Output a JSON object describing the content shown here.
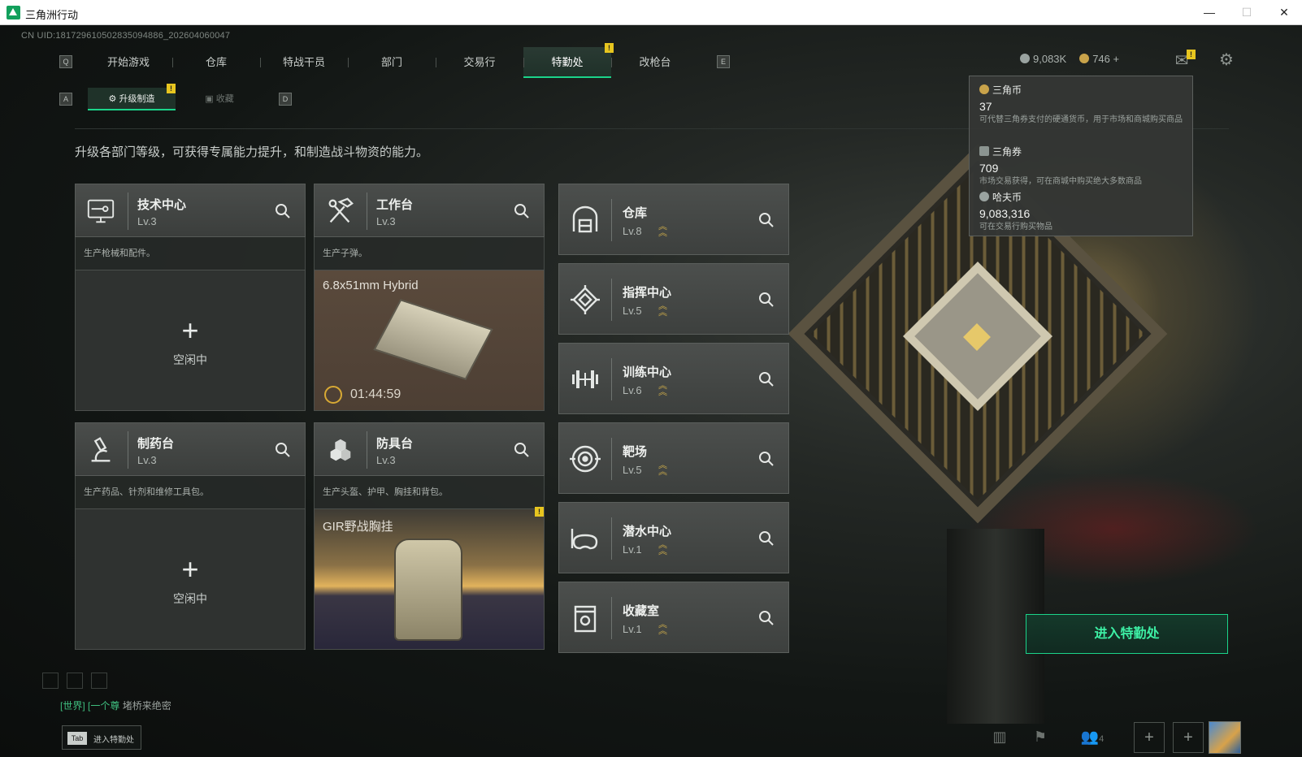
{
  "window": {
    "title": "三角洲行动",
    "minimize": "—",
    "maximize": "☐",
    "close": "✕"
  },
  "uid": "CN UID:18172961050283509488​6_202604060047",
  "nav": {
    "key_left": "Q",
    "key_right": "E",
    "tabs": [
      "开始游戏",
      "仓库",
      "特战干员",
      "部门",
      "交易行",
      "特勤处",
      "改枪台"
    ],
    "active_tab": "特勤处",
    "badge": "!"
  },
  "subnav": {
    "key_left": "A",
    "key_right": "D",
    "items": [
      "升级制造",
      "收藏"
    ],
    "active": "升级制造",
    "badge": "!"
  },
  "currency": {
    "hafcoin": "9,083K",
    "triangle": "746",
    "add": "+",
    "mail_badge": "!"
  },
  "intro": "升级各部门等级，可获得专属能力提升，和制造战斗物资的能力。",
  "workshops": [
    {
      "name": "技术中心",
      "level": "Lv.3",
      "icon": "monitor-icon",
      "desc": "生产枪械和配件。",
      "status": "空闲中",
      "plus": "+"
    },
    {
      "name": "工作台",
      "level": "Lv.3",
      "icon": "tools-icon",
      "desc": "生产子弹。",
      "item": "6.8x51mm Hybrid",
      "timer": "01:44:59"
    },
    {
      "name": "制药台",
      "level": "Lv.3",
      "icon": "microscope-icon",
      "desc": "生产药品、针剂和维修工具包。",
      "status": "空闲中",
      "plus": "+"
    },
    {
      "name": "防具台",
      "level": "Lv.3",
      "icon": "boxes-icon",
      "desc": "生产头盔、护甲、胸挂和背包。",
      "item": "GIR野战胸挂",
      "badge": "!"
    }
  ],
  "facilities": [
    {
      "name": "仓库",
      "level": "Lv.8",
      "icon": "warehouse-icon"
    },
    {
      "name": "指挥中心",
      "level": "Lv.5",
      "icon": "command-icon"
    },
    {
      "name": "训练中心",
      "level": "Lv.6",
      "icon": "dumbbell-icon"
    },
    {
      "name": "靶场",
      "level": "Lv.5",
      "icon": "target-icon"
    },
    {
      "name": "潜水中心",
      "level": "Lv.1",
      "icon": "diving-mask-icon"
    },
    {
      "name": "收藏室",
      "level": "Lv.1",
      "icon": "collection-icon"
    }
  ],
  "tooltip": [
    {
      "name": "三角币",
      "value": "37",
      "desc": "可代替三角券支付的硬通货币，用于市场和商城购买商品"
    },
    {
      "name": "三角券",
      "value": "709",
      "desc": "市场交易获得，可在商城中购买绝大多数商品"
    },
    {
      "name": "哈夫币",
      "value": "9,083,316",
      "desc": "可在交易行购买物品"
    }
  ],
  "enter_button": "进入特勤处",
  "chat": {
    "channel": "[世界]",
    "user": "[一个尊",
    "message": "堵桥来绝密"
  },
  "tab_hint": {
    "key": "Tab",
    "label": "进入特勤处"
  },
  "bottom": {
    "friends_count": "4"
  },
  "colors": {
    "accent": "#1bd48a",
    "badge": "#e7c51f",
    "upgrade": "#d6b24a"
  }
}
